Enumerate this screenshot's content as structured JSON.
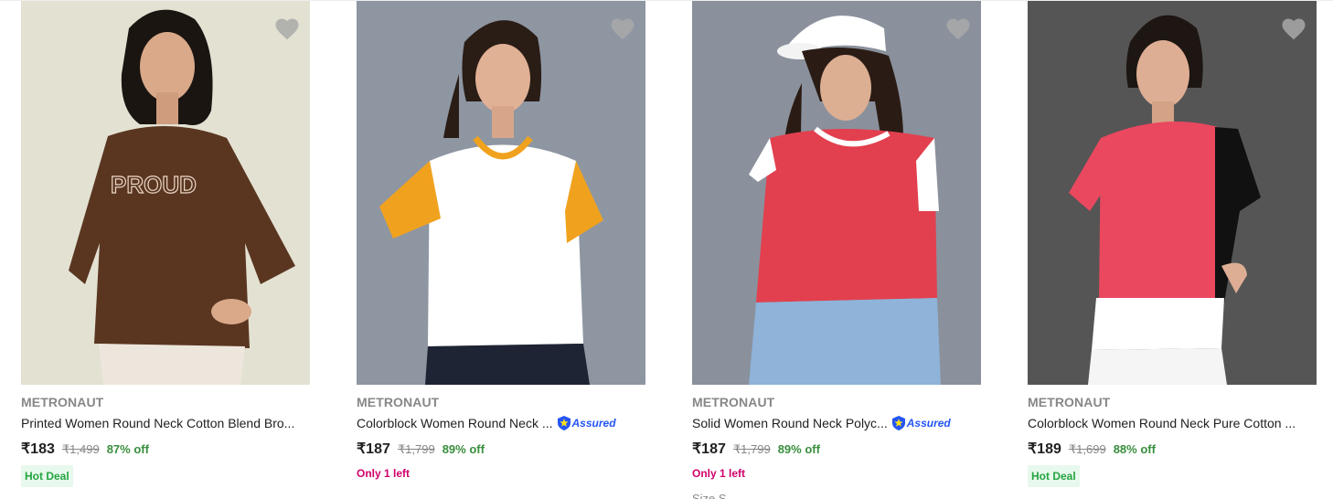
{
  "products": [
    {
      "brand": "METRONAUT",
      "title": "Printed Women Round Neck Cotton Blend Bro...",
      "assured": false,
      "price": "₹183",
      "mrp": "₹1,499",
      "discount": "87% off",
      "tag": "Hot Deal",
      "image_print_text": "PROUD",
      "image_background": "#e3e1d2",
      "shirt_color": "#5a3621"
    },
    {
      "brand": "METRONAUT",
      "title": "Colorblock Women Round Neck ...",
      "assured": true,
      "assured_label": "Assured",
      "price": "₹187",
      "mrp": "₹1,799",
      "discount": "89% off",
      "stock": "Only 1 left",
      "image_background": "#8e96a2",
      "shirt_color": "#ffffff",
      "sleeve_color": "#f0a21e"
    },
    {
      "brand": "METRONAUT",
      "title": "Solid Women Round Neck Polyc...",
      "assured": true,
      "assured_label": "Assured",
      "price": "₹187",
      "mrp": "₹1,799",
      "discount": "89% off",
      "stock": "Only 1 left",
      "size_label": "Size S",
      "image_background": "#8a919c",
      "shirt_color": "#e2404f",
      "sleeve_color": "#ffffff"
    },
    {
      "brand": "METRONAUT",
      "title": "Colorblock Women Round Neck Pure Cotton ...",
      "assured": false,
      "price": "₹189",
      "mrp": "₹1,699",
      "discount": "88% off",
      "tag": "Hot Deal",
      "image_background": "#555555",
      "shirt_color": "#e9485f",
      "sleeve_color": "#111111"
    }
  ]
}
